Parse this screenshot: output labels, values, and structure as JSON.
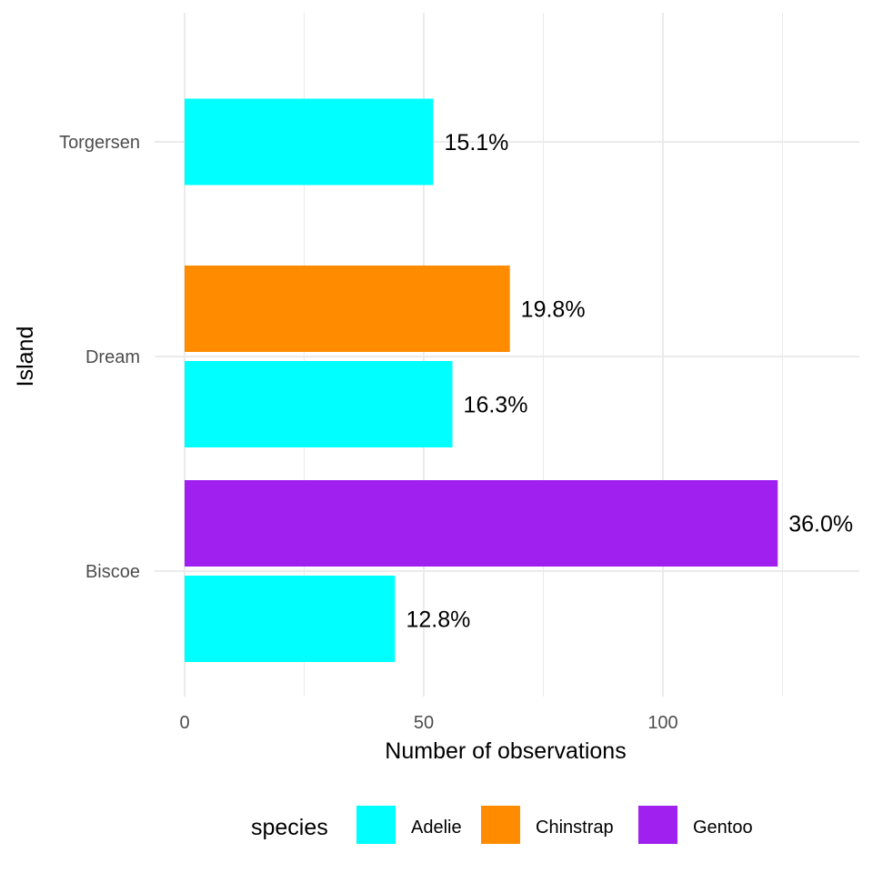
{
  "chart_data": {
    "type": "bar",
    "orientation": "horizontal",
    "title": "",
    "xlabel": "Number of observations",
    "ylabel": "Island",
    "xlim": [
      0,
      140
    ],
    "x_ticks": [
      0,
      50,
      100
    ],
    "grid": true,
    "categories": [
      "Biscoe",
      "Dream",
      "Torgersen"
    ],
    "legend": {
      "title": "species",
      "position": "bottom",
      "entries": [
        {
          "name": "Adelie",
          "color": "#00FFFF"
        },
        {
          "name": "Chinstrap",
          "color": "#FF8C00"
        },
        {
          "name": "Gentoo",
          "color": "#A020F0"
        }
      ]
    },
    "bars": [
      {
        "island": "Biscoe",
        "species": "Adelie",
        "value": 44,
        "label": "12.8%"
      },
      {
        "island": "Biscoe",
        "species": "Gentoo",
        "value": 124,
        "label": "36.0%"
      },
      {
        "island": "Dream",
        "species": "Adelie",
        "value": 56,
        "label": "16.3%"
      },
      {
        "island": "Dream",
        "species": "Chinstrap",
        "value": 68,
        "label": "19.8%"
      },
      {
        "island": "Torgersen",
        "species": "Adelie",
        "value": 52,
        "label": "15.1%"
      }
    ]
  }
}
